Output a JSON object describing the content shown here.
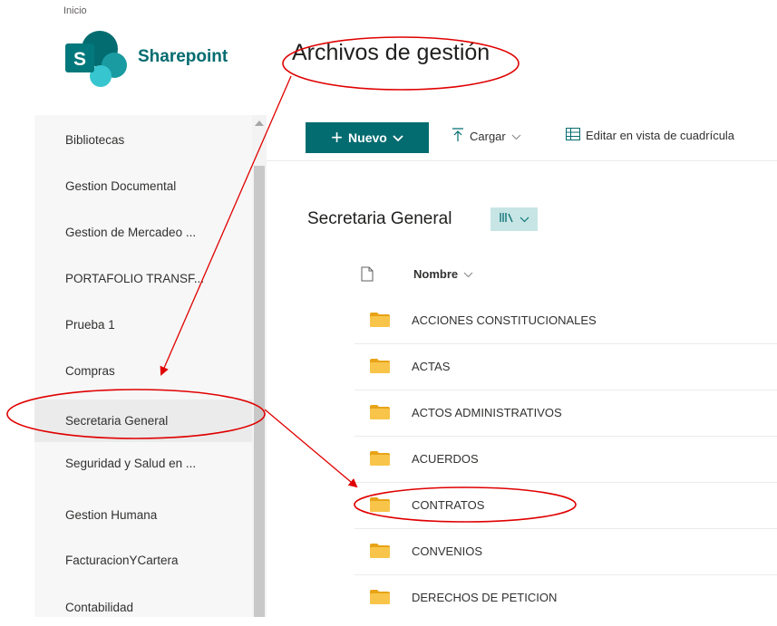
{
  "breadcrumb": "Inicio",
  "brand": {
    "name": "Sharepoint",
    "logo_icon": "sharepoint-logo-icon",
    "logo_letter": "S"
  },
  "site_title": "Archivos de gestión",
  "sidebar": {
    "items": [
      {
        "label": "Bibliotecas"
      },
      {
        "label": "Gestion Documental"
      },
      {
        "label": "Gestion de Mercadeo ..."
      },
      {
        "label": "PORTAFOLIO TRANSF..."
      },
      {
        "label": "Prueba 1"
      },
      {
        "label": "Compras"
      },
      {
        "label": "Secretaria General"
      },
      {
        "label": "Seguridad y Salud en ..."
      },
      {
        "label": "Gestion Humana"
      },
      {
        "label": "FacturacionYCartera"
      },
      {
        "label": "Contabilidad"
      }
    ],
    "selected_index": 6
  },
  "commands": {
    "new_label": "Nuevo",
    "upload_label": "Cargar",
    "grid_label": "Editar en vista de cuadrícula"
  },
  "library": {
    "title": "Secretaria General",
    "column_name": "Nombre",
    "folders": [
      {
        "name": "ACCIONES CONSTITUCIONALES"
      },
      {
        "name": "ACTAS"
      },
      {
        "name": "ACTOS ADMINISTRATIVOS"
      },
      {
        "name": "ACUERDOS"
      },
      {
        "name": "CONTRATOS"
      },
      {
        "name": "CONVENIOS"
      },
      {
        "name": "DERECHOS DE PETICION"
      }
    ]
  },
  "colors": {
    "accent": "#036c70",
    "annotation": "#e00000",
    "folder": "#f8c54a"
  }
}
